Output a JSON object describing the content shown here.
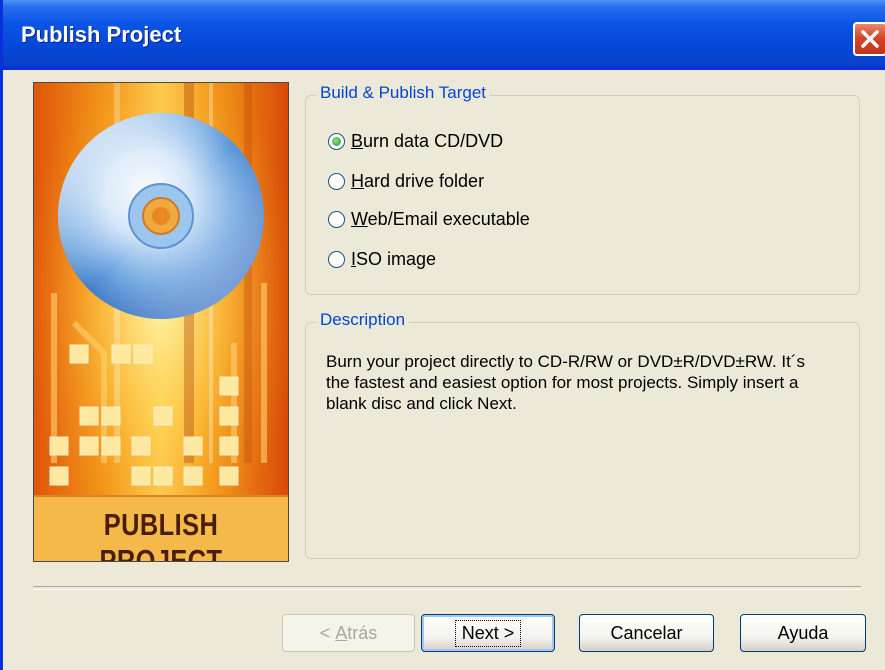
{
  "window": {
    "title": "Publish Project"
  },
  "banner": {
    "caption": "PUBLISH PROJECT",
    "icon": "cd-disc-icon"
  },
  "target_group": {
    "legend": "Build & Publish Target",
    "options": [
      {
        "accel": "B",
        "rest": "urn data CD/DVD",
        "selected": true
      },
      {
        "accel": "H",
        "rest": "ard drive folder",
        "selected": false
      },
      {
        "accel": "W",
        "rest": "eb/Email executable",
        "selected": false
      },
      {
        "accel": "I",
        "rest": "SO image",
        "selected": false
      }
    ]
  },
  "description_group": {
    "legend": "Description",
    "text": "Burn your project directly to CD-R/RW or DVD±R/DVD±RW. It´s the fastest and easiest option for most projects. Simply insert a blank disc and click Next."
  },
  "buttons": {
    "back": {
      "prefix": "< ",
      "accel": "A",
      "rest": "trás",
      "enabled": false
    },
    "next": "Next >",
    "cancel": "Cancelar",
    "help": "Ayuda"
  },
  "colors": {
    "title_bar": "#0548d8",
    "legend_text": "#0046d5",
    "window_bg": "#ece9d8",
    "banner_orange": "#f08a10"
  }
}
